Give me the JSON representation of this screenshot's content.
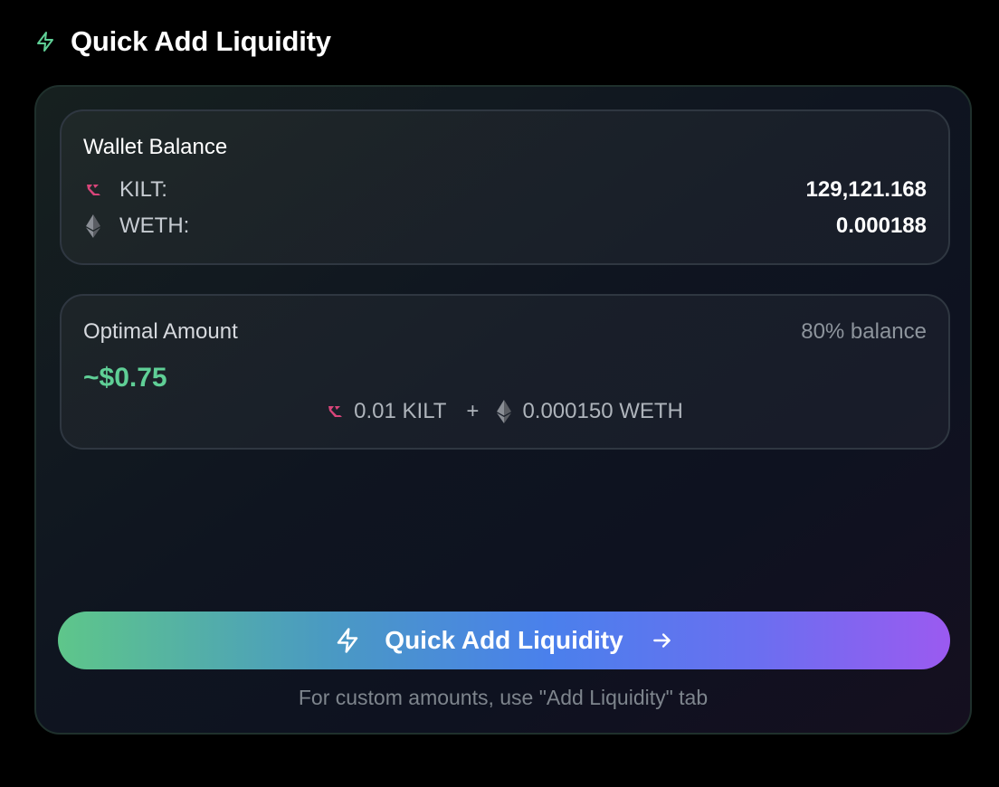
{
  "header": {
    "icon": "lightning-icon",
    "title": "Quick Add Liquidity"
  },
  "wallet": {
    "title": "Wallet Balance",
    "items": [
      {
        "icon": "kilt-token-icon",
        "label": "KILT:",
        "value": "129,121.168"
      },
      {
        "icon": "ethereum-icon",
        "label": "WETH:",
        "value": "0.000188"
      }
    ]
  },
  "optimal": {
    "title": "Optimal Amount",
    "balance_pct": "80% balance",
    "usd": "~$0.75",
    "kilt_amount": "0.01 KILT",
    "plus": "+",
    "weth_amount": "0.000150 WETH"
  },
  "cta": {
    "icon": "lightning-icon",
    "label": "Quick Add Liquidity",
    "arrow_icon": "arrow-right-icon"
  },
  "hint": "For custom amounts, use \"Add Liquidity\" tab",
  "colors": {
    "accent_green": "#5fcf96",
    "kilt_pink": "#d9457a",
    "gradient_start": "#5ec68a",
    "gradient_mid": "#4a80ec",
    "gradient_end": "#9b5af0"
  }
}
